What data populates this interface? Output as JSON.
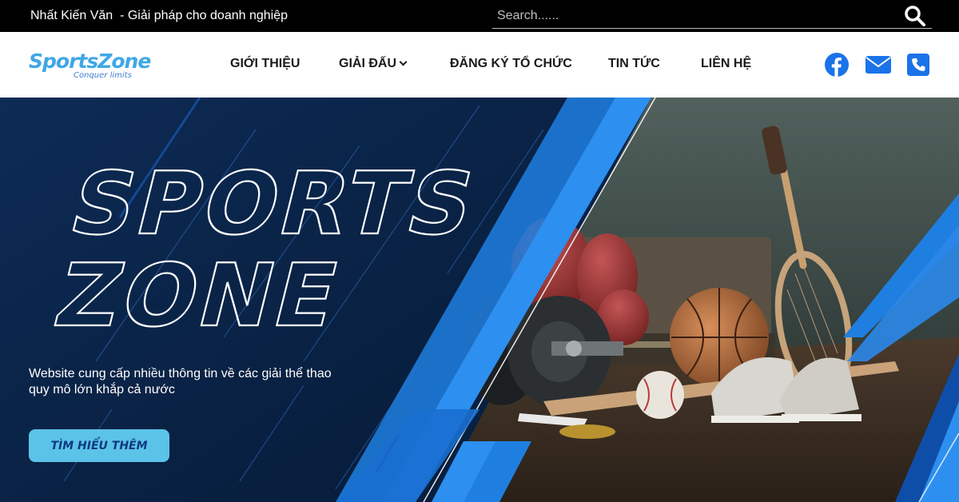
{
  "topbar": {
    "tagline": "Nhất Kiến Văn  - Giải pháp cho doanh nghiệp",
    "search_placeholder": "Search......",
    "search_icon": "magnifier-icon"
  },
  "logo": {
    "main": "SportsZone",
    "sub": "Conquer limits"
  },
  "menu": [
    {
      "label": "GIỚI THIỆU"
    },
    {
      "label": "GIẢI ĐẤU",
      "has_dropdown": true
    },
    {
      "label": "ĐĂNG KÝ TỔ CHỨC"
    },
    {
      "label": "TIN TỨC"
    },
    {
      "label": "LIÊN HỆ"
    }
  ],
  "social": {
    "icons": [
      "facebook-icon",
      "mail-icon",
      "phone-icon"
    ],
    "color": "#1a73e8"
  },
  "hero": {
    "title_line1": "SPORTS",
    "title_line2": "ZONE",
    "description": "Website cung cấp nhiều thông tin về các giải thể thao\nquy  mô lớn khắp cả nước",
    "cta_label": "TÌM HIỂU THÊM"
  },
  "colors": {
    "navy": "#0b2346",
    "accent_blue": "#1f7fe0",
    "cta_bg": "#5cc3e8",
    "cta_text": "#0e3a82"
  }
}
